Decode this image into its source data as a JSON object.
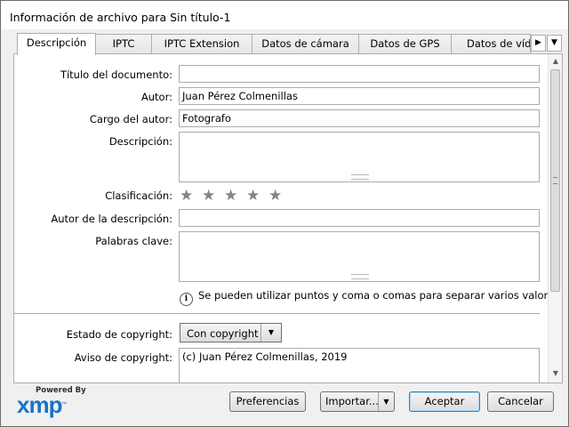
{
  "window": {
    "title": "Información de archivo para Sin título-1"
  },
  "tabs": [
    {
      "label": "Descripción"
    },
    {
      "label": "IPTC"
    },
    {
      "label": "IPTC Extension"
    },
    {
      "label": "Datos de cámara"
    },
    {
      "label": "Datos de GPS"
    },
    {
      "label": "Datos de vídeo"
    }
  ],
  "form": {
    "doc_title": {
      "label": "Título del documento:",
      "value": ""
    },
    "author": {
      "label": "Autor:",
      "value": "Juan Pérez Colmenillas"
    },
    "author_title": {
      "label": "Cargo del autor:",
      "value": "Fotografo"
    },
    "description": {
      "label": "Descripción:",
      "value": ""
    },
    "rating": {
      "label": "Clasificación:",
      "stars_total": 5,
      "stars_selected": 0
    },
    "description_writer": {
      "label": "Autor de la descripción:",
      "value": ""
    },
    "keywords": {
      "label": "Palabras clave:",
      "value": ""
    },
    "keywords_hint": "Se pueden utilizar puntos y coma o comas para separar varios valores",
    "copyright_status": {
      "label": "Estado de copyright:",
      "selected": "Con copyright"
    },
    "copyright_notice": {
      "label": "Aviso de copyright:",
      "value": "(c) Juan Pérez Colmenillas, 2019"
    }
  },
  "footer": {
    "powered_by": "Powered By",
    "logo_text": "xmp",
    "logo_tm": "™",
    "preferences": "Preferencias",
    "import": "Importar...",
    "ok": "Aceptar",
    "cancel": "Cancelar"
  },
  "icons": {
    "star": "star-icon",
    "info": "info-icon",
    "dropdown": "chevron-down-icon",
    "tab_scroll_right": "triangle-right-icon"
  },
  "colors": {
    "logo_blue": "#1a73c7",
    "star_gray": "#848484"
  }
}
